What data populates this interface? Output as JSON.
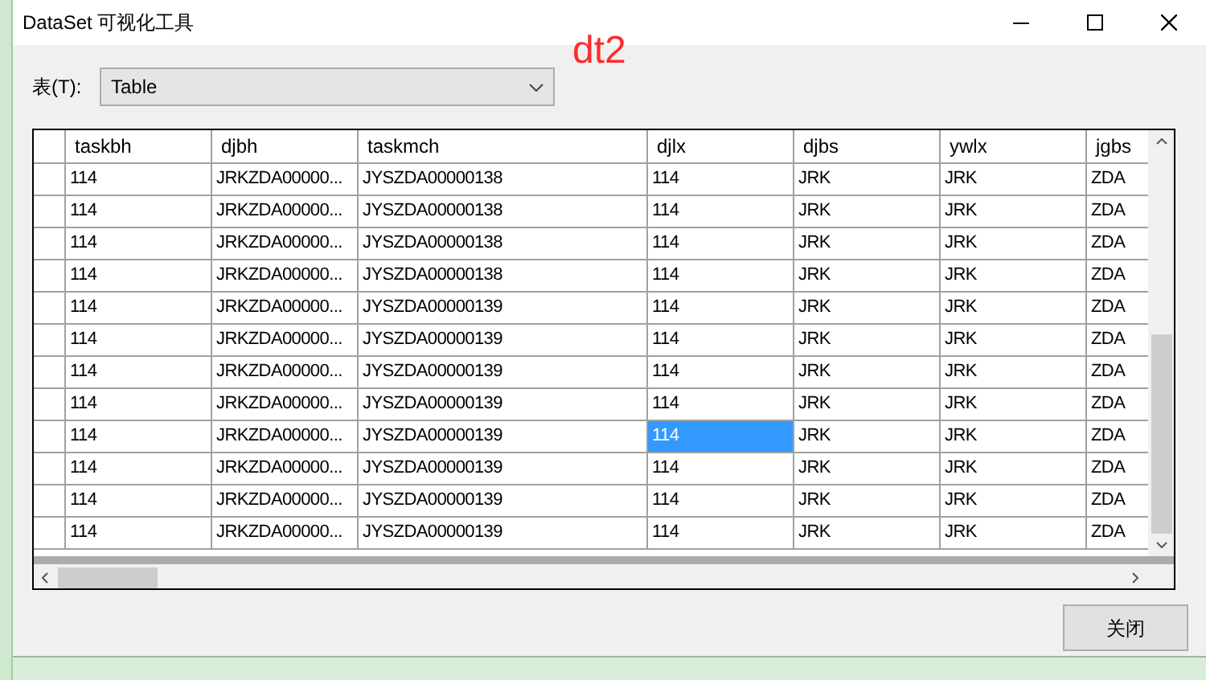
{
  "window": {
    "title": "DataSet 可视化工具"
  },
  "table_picker": {
    "label": "表(T):",
    "value": "Table"
  },
  "annotation": "dt2",
  "table": {
    "columns": [
      "taskbh",
      "djbh",
      "taskmch",
      "djlx",
      "djbs",
      "ywlx",
      "jgbs"
    ],
    "rows": [
      [
        {
          "text": "114",
          "selected": false
        },
        {
          "text": "JRKZDA00000...",
          "selected": false
        },
        {
          "text": "JYSZDA00000138",
          "selected": false
        },
        {
          "text": "114",
          "selected": false
        },
        {
          "text": "JRK",
          "selected": false
        },
        {
          "text": "JRK",
          "selected": false
        },
        {
          "text": "ZDA",
          "selected": false
        }
      ],
      [
        {
          "text": "114",
          "selected": false
        },
        {
          "text": "JRKZDA00000...",
          "selected": false
        },
        {
          "text": "JYSZDA00000138",
          "selected": false
        },
        {
          "text": "114",
          "selected": false
        },
        {
          "text": "JRK",
          "selected": false
        },
        {
          "text": "JRK",
          "selected": false
        },
        {
          "text": "ZDA",
          "selected": false
        }
      ],
      [
        {
          "text": "114",
          "selected": false
        },
        {
          "text": "JRKZDA00000...",
          "selected": false
        },
        {
          "text": "JYSZDA00000138",
          "selected": false
        },
        {
          "text": "114",
          "selected": false
        },
        {
          "text": "JRK",
          "selected": false
        },
        {
          "text": "JRK",
          "selected": false
        },
        {
          "text": "ZDA",
          "selected": false
        }
      ],
      [
        {
          "text": "114",
          "selected": false
        },
        {
          "text": "JRKZDA00000...",
          "selected": false
        },
        {
          "text": "JYSZDA00000138",
          "selected": false
        },
        {
          "text": "114",
          "selected": false
        },
        {
          "text": "JRK",
          "selected": false
        },
        {
          "text": "JRK",
          "selected": false
        },
        {
          "text": "ZDA",
          "selected": false
        }
      ],
      [
        {
          "text": "114",
          "selected": false
        },
        {
          "text": "JRKZDA00000...",
          "selected": false
        },
        {
          "text": "JYSZDA00000139",
          "selected": false
        },
        {
          "text": "114",
          "selected": false
        },
        {
          "text": "JRK",
          "selected": false
        },
        {
          "text": "JRK",
          "selected": false
        },
        {
          "text": "ZDA",
          "selected": false
        }
      ],
      [
        {
          "text": "114",
          "selected": false
        },
        {
          "text": "JRKZDA00000...",
          "selected": false
        },
        {
          "text": "JYSZDA00000139",
          "selected": false
        },
        {
          "text": "114",
          "selected": false
        },
        {
          "text": "JRK",
          "selected": false
        },
        {
          "text": "JRK",
          "selected": false
        },
        {
          "text": "ZDA",
          "selected": false
        }
      ],
      [
        {
          "text": "114",
          "selected": false
        },
        {
          "text": "JRKZDA00000...",
          "selected": false
        },
        {
          "text": "JYSZDA00000139",
          "selected": false
        },
        {
          "text": "114",
          "selected": false
        },
        {
          "text": "JRK",
          "selected": false
        },
        {
          "text": "JRK",
          "selected": false
        },
        {
          "text": "ZDA",
          "selected": false
        }
      ],
      [
        {
          "text": "114",
          "selected": false
        },
        {
          "text": "JRKZDA00000...",
          "selected": false
        },
        {
          "text": "JYSZDA00000139",
          "selected": false
        },
        {
          "text": "114",
          "selected": false
        },
        {
          "text": "JRK",
          "selected": false
        },
        {
          "text": "JRK",
          "selected": false
        },
        {
          "text": "ZDA",
          "selected": false
        }
      ],
      [
        {
          "text": "114",
          "selected": false
        },
        {
          "text": "JRKZDA00000...",
          "selected": false
        },
        {
          "text": "JYSZDA00000139",
          "selected": false
        },
        {
          "text": "114",
          "selected": true
        },
        {
          "text": "JRK",
          "selected": false
        },
        {
          "text": "JRK",
          "selected": false
        },
        {
          "text": "ZDA",
          "selected": false
        }
      ],
      [
        {
          "text": "114",
          "selected": false
        },
        {
          "text": "JRKZDA00000...",
          "selected": false
        },
        {
          "text": "JYSZDA00000139",
          "selected": false
        },
        {
          "text": "114",
          "selected": false
        },
        {
          "text": "JRK",
          "selected": false
        },
        {
          "text": "JRK",
          "selected": false
        },
        {
          "text": "ZDA",
          "selected": false
        }
      ],
      [
        {
          "text": "114",
          "selected": false
        },
        {
          "text": "JRKZDA00000...",
          "selected": false
        },
        {
          "text": "JYSZDA00000139",
          "selected": false
        },
        {
          "text": "114",
          "selected": false
        },
        {
          "text": "JRK",
          "selected": false
        },
        {
          "text": "JRK",
          "selected": false
        },
        {
          "text": "ZDA",
          "selected": false
        }
      ],
      [
        {
          "text": "114",
          "selected": false
        },
        {
          "text": "JRKZDA00000...",
          "selected": false
        },
        {
          "text": "JYSZDA00000139",
          "selected": false
        },
        {
          "text": "114",
          "selected": false
        },
        {
          "text": "JRK",
          "selected": false
        },
        {
          "text": "JRK",
          "selected": false
        },
        {
          "text": "ZDA",
          "selected": false
        }
      ]
    ]
  },
  "buttons": [
    "关闭"
  ]
}
